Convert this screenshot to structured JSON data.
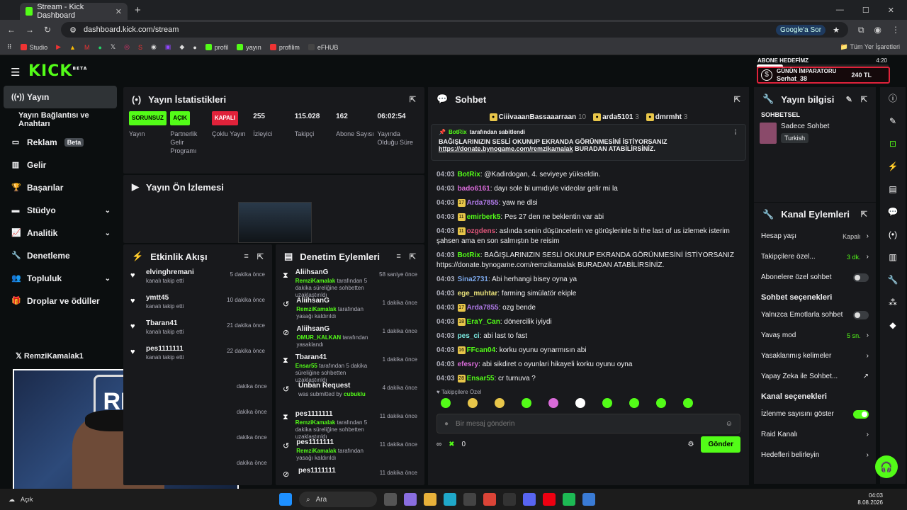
{
  "browser": {
    "tab_title": "Stream - Kick Dashboard",
    "url": "dashboard.kick.com/stream",
    "ask_google": "Google'a Sor",
    "bookmarks": [
      "Studio",
      "profil",
      "yayın",
      "profilim",
      "eFHUB"
    ],
    "all_bookmarks": "Tüm Yer İşaretleri"
  },
  "header": {
    "logo": "KICK",
    "logo_sup": "BETA",
    "goal_title": "ABONE HEDEFİMZ",
    "goal_time": "4:20",
    "goal_progress": 0.2,
    "emperor_title": "GÜNÜN İMPARATORU",
    "emperor_name": "Serhat_38",
    "emperor_amount": "240 TL"
  },
  "sidebar": {
    "items": [
      {
        "label": "Yayın",
        "icon": "broadcast-icon"
      },
      {
        "label": "Yayın Bağlantısı ve Anahtarı"
      },
      {
        "label": "Reklam",
        "badge": "Beta"
      },
      {
        "label": "Gelir"
      },
      {
        "label": "Başarılar"
      },
      {
        "label": "Stüdyo"
      },
      {
        "label": "Analitik"
      },
      {
        "label": "Denetleme"
      },
      {
        "label": "Topluluk"
      },
      {
        "label": "Droplar ve ödüller"
      }
    ],
    "twitter": "𝕏 RemziKamalak1"
  },
  "stats": {
    "title": "Yayın İstatistikleri",
    "items": [
      {
        "value": "SORUNSUZ",
        "label": "Yayın",
        "color": "#53fc18"
      },
      {
        "value": "AÇIK",
        "label": "Partnerlik Gelir Programı",
        "color": "#53fc18"
      },
      {
        "value": "KAPALI",
        "label": "Çoklu Yayın",
        "color": "#e0223a"
      },
      {
        "value": "255",
        "label": "İzleyici"
      },
      {
        "value": "115.028",
        "label": "Takipçi"
      },
      {
        "value": "162",
        "label": "Abone Sayısı"
      },
      {
        "value": "06:02:54",
        "label": "Yayında Olduğu Süre"
      }
    ]
  },
  "preview": {
    "title": "Yayın Ön İzlemesi"
  },
  "activity": {
    "title": "Etkinlik Akışı",
    "items": [
      {
        "name": "elvinghremani",
        "sub": "kanalı takip etti",
        "time": "5 dakika önce"
      },
      {
        "name": "ymtt45",
        "sub": "kanalı takip etti",
        "time": "10 dakika önce"
      },
      {
        "name": "Tbaran41",
        "sub": "kanalı takip etti",
        "time": "21 dakika önce"
      },
      {
        "name": "pes1111111",
        "sub": "kanalı takip etti",
        "time": "22 dakika önce"
      }
    ],
    "hidden_times": [
      "dakika önce",
      "dakika önce",
      "dakika önce",
      "dakika önce"
    ]
  },
  "moderation": {
    "title": "Denetim Eylemleri",
    "items": [
      {
        "icon": "hourglass-icon",
        "name": "AliihsanG",
        "mod": "RemziKamalak",
        "sub": " tarafından 5 dakika süreliğine sohbetten uzaklaştırıldı",
        "time": "58 saniye önce"
      },
      {
        "icon": "undo-icon",
        "name": "AliihsanG",
        "mod": "RemziKamalak",
        "sub": " tarafından yasağı kaldırıldı",
        "time": "1 dakika önce"
      },
      {
        "icon": "ban-icon",
        "name": "AliihsanG",
        "mod": "OMUR_KALKAN",
        "sub": " tarafından yasaklandı",
        "time": "1 dakika önce"
      },
      {
        "icon": "hourglass-icon",
        "name": "Tbaran41",
        "mod": "Ensar55",
        "sub": " tarafından 5 dakika süreliğine sohbetten uzaklaştırıldı",
        "time": "1 dakika önce"
      },
      {
        "icon": "undo-icon",
        "name": "Unban Request",
        "mod": "cubuklu",
        "sub": "was submitted by ",
        "time": "4 dakika önce"
      },
      {
        "icon": "hourglass-icon",
        "name": "pes1111111",
        "mod": "RemziKamalak",
        "sub": " tarafından 5 dakika süreliğine sohbetten uzaklaştırıldı",
        "time": "11 dakika önce"
      },
      {
        "icon": "undo-icon",
        "name": "pes1111111",
        "mod": "RemziKamalak",
        "sub": " tarafından yasağı kaldırıldı",
        "time": "11 dakika önce"
      },
      {
        "icon": "ban-icon",
        "name": "pes1111111",
        "mod": "",
        "sub": "",
        "time": "11 dakika önce"
      }
    ]
  },
  "chat": {
    "title": "Sohbet",
    "gifters": [
      {
        "name": "CiiivaaanBassaaarraan",
        "n": "10"
      },
      {
        "name": "arda5101",
        "n": "3"
      },
      {
        "name": "dmrmht",
        "n": "3"
      }
    ],
    "pinned_by": "BotRix",
    "pinned_suffix": "tarafından sabitlendi",
    "pinned_text": "BAĞIŞLARINIZIN SESLİ OKUNUP EKRANDA GÖRÜNMESİNİ İSTİYORSANIZ",
    "pinned_link": "https://donate.bynogame.com/remzikamalak",
    "pinned_end": "BURADAN ATABİLİRSİNİZ.",
    "messages": [
      {
        "t": "04:03",
        "u": "BotRix",
        "c": "#53fc18",
        "m": "@Kadirdogan, 4. seviyeye yükseldin."
      },
      {
        "t": "04:03",
        "u": "bado6161",
        "c": "#d96bd9",
        "m": "dayı sole bi umıdıyle videolar gelir mi la"
      },
      {
        "t": "04:03",
        "u": "Arda7855",
        "c": "#b07ae8",
        "m": "yaw ne dlsi",
        "b": "17"
      },
      {
        "t": "04:03",
        "u": "emirberk5",
        "c": "#53fc18",
        "m": "Pes 27 den ne beklentin var abi",
        "b": "11"
      },
      {
        "t": "04:03",
        "u": "ozgdens",
        "c": "#e0557a",
        "m": "aslında senin düşüncelerin ve görüşlerinle bi the last of us izlemek isterim şahsen ama en son salmıştın be reisim",
        "b": "11"
      },
      {
        "t": "04:03",
        "u": "BotRix",
        "c": "#53fc18",
        "m": "BAĞIŞLARINIZIN SESLİ OKUNUP EKRANDA GÖRÜNMESİNİ İSTİYORSANIZ https://donate.bynogame.com/remzikamalak BURADAN ATABİLİRSİNİZ."
      },
      {
        "t": "04:03",
        "u": "Sina2731",
        "c": "#7aa6e8",
        "m": "Abi herhangi bisey oyna ya"
      },
      {
        "t": "04:03",
        "u": "ege_muhtar",
        "c": "#e8e07a",
        "m": "farming simülatör ekiple"
      },
      {
        "t": "04:03",
        "u": "Arda7855",
        "c": "#b07ae8",
        "m": "ozg bende",
        "b": "17"
      },
      {
        "t": "04:03",
        "u": "EraY_Can",
        "c": "#53fc18",
        "m": "dönercilik iyiydi",
        "b": "18"
      },
      {
        "t": "04:03",
        "u": "pes_ci",
        "c": "#7ae8e0",
        "m": "abi last to fast"
      },
      {
        "t": "04:03",
        "u": "FFcan04",
        "c": "#53fc18",
        "m": "korku oyunu oynarmısın abi",
        "b": "16"
      },
      {
        "t": "04:03",
        "u": "efesry",
        "c": "#d96bd9",
        "m": "abi sikdiret o oyunlari hikayeli korku oyunu oyna"
      },
      {
        "t": "04:03",
        "u": "Ensar55",
        "c": "#53fc18",
        "m": "cr turnuva ?",
        "b": "28"
      }
    ],
    "followers_only": "Takipçilere Özel",
    "placeholder": "Bir mesaj gönderin",
    "count": "0",
    "send": "Gönder"
  },
  "info": {
    "title": "Yayın bilgisi",
    "category_label": "SOHBETSEL",
    "category": "Sadece Sohbet",
    "language": "Turkish",
    "actions_title": "Kanal Eylemleri",
    "rows1": [
      {
        "label": "Hesap yaşı",
        "value": "Kapalı"
      },
      {
        "label": "Takipçilere özel...",
        "value": "3 dk."
      },
      {
        "label": "Abonelere özel sohbet",
        "toggle": false
      }
    ],
    "chat_opts": "Sohbet seçenekleri",
    "rows2": [
      {
        "label": "Yalnızca Emotlarla sohbet",
        "toggle": false
      },
      {
        "label": "Yavaş mod",
        "value": "5 sn."
      },
      {
        "label": "Yasaklanmış kelimeler"
      },
      {
        "label": "Yapay Zeka ile Sohbet..."
      }
    ],
    "channel_opts": "Kanal seçenekleri",
    "rows3": [
      {
        "label": "İzlenme sayısını göster",
        "toggle": true
      },
      {
        "label": "Raid Kanalı"
      },
      {
        "label": "Hedefleri belirleyin"
      }
    ]
  },
  "taskbar": {
    "left": "Açık",
    "search": "Ara",
    "time": "04:03",
    "date": "8.08.2026"
  }
}
